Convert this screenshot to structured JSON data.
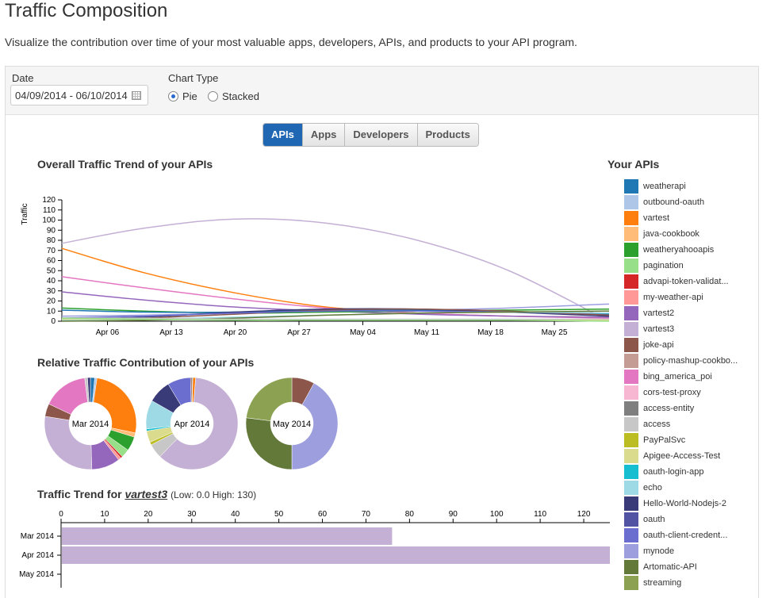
{
  "page": {
    "title": "Traffic Composition",
    "description": "Visualize the contribution over time of your most valuable apps, developers, APIs, and products to your API program."
  },
  "filters": {
    "date_label": "Date",
    "date_value": "04/09/2014 - 06/10/2014",
    "chart_type_label": "Chart Type",
    "chart_type_options": [
      "Pie",
      "Stacked"
    ],
    "chart_type_selected": "Pie"
  },
  "tabs": [
    {
      "label": "APIs",
      "active": true
    },
    {
      "label": "Apps",
      "active": false
    },
    {
      "label": "Developers",
      "active": false
    },
    {
      "label": "Products",
      "active": false
    }
  ],
  "sections": {
    "trend_title": "Overall Traffic Trend of your APIs",
    "relative_title": "Relative Traffic Contribution of your APIs",
    "legend_title": "Your APIs",
    "bar_title_prefix": "Traffic Trend for",
    "bar_title_api": "vartest3",
    "bar_title_range": "(Low: 0.0 High: 130)"
  },
  "legend": [
    {
      "name": "weatherapi",
      "color": "#1f77b4"
    },
    {
      "name": "outbound-oauth",
      "color": "#aec7e8"
    },
    {
      "name": "vartest",
      "color": "#ff7f0e"
    },
    {
      "name": "java-cookbook",
      "color": "#ffbb78"
    },
    {
      "name": "weatheryahooapis",
      "color": "#2ca02c"
    },
    {
      "name": "pagination",
      "color": "#98df8a"
    },
    {
      "name": "advapi-token-validat...",
      "color": "#d62728"
    },
    {
      "name": "my-weather-api",
      "color": "#ff9896"
    },
    {
      "name": "vartest2",
      "color": "#9467bd"
    },
    {
      "name": "vartest3",
      "color": "#c5b0d5"
    },
    {
      "name": "joke-api",
      "color": "#8c564b"
    },
    {
      "name": "policy-mashup-cookbo...",
      "color": "#c49c94"
    },
    {
      "name": "bing_america_poi",
      "color": "#e377c2"
    },
    {
      "name": "cors-test-proxy",
      "color": "#f7b6d2"
    },
    {
      "name": "access-entity",
      "color": "#7f7f7f"
    },
    {
      "name": "access",
      "color": "#c7c7c7"
    },
    {
      "name": "PayPalSvc",
      "color": "#bcbd22"
    },
    {
      "name": "Apigee-Access-Test",
      "color": "#dbdb8d"
    },
    {
      "name": "oauth-login-app",
      "color": "#17becf"
    },
    {
      "name": "echo",
      "color": "#9edae5"
    },
    {
      "name": "Hello-World-Nodejs-2",
      "color": "#393b79"
    },
    {
      "name": "oauth",
      "color": "#5254a3"
    },
    {
      "name": "oauth-client-credent...",
      "color": "#6b6ecf"
    },
    {
      "name": "mynode",
      "color": "#9c9ede"
    },
    {
      "name": "Artomatic-API",
      "color": "#637939"
    },
    {
      "name": "streaming",
      "color": "#8ca252"
    }
  ],
  "chart_data": [
    {
      "type": "line",
      "title": "Overall Traffic Trend of your APIs",
      "ylabel": "Traffic",
      "ylim": [
        0,
        120
      ],
      "yticks": [
        0,
        10,
        20,
        30,
        40,
        50,
        60,
        70,
        80,
        90,
        100,
        110,
        120
      ],
      "xticks": [
        "Apr 06",
        "Apr 13",
        "Apr 20",
        "Apr 27",
        "May 04",
        "May 11",
        "May 18",
        "May 25"
      ],
      "x": [
        "2014-04-01",
        "2014-04-10",
        "2014-04-20",
        "2014-04-30",
        "2014-05-10",
        "2014-05-20",
        "2014-05-31"
      ],
      "series": [
        {
          "name": "vartest3",
          "color": "#c5b0d5",
          "values": [
            77,
            92,
            101,
            97,
            80,
            50,
            0
          ]
        },
        {
          "name": "vartest",
          "color": "#ff7f0e",
          "values": [
            72,
            48,
            28,
            14,
            8,
            5,
            4
          ]
        },
        {
          "name": "bing_america_poi",
          "color": "#e377c2",
          "values": [
            44,
            33,
            22,
            13,
            8,
            5,
            3
          ]
        },
        {
          "name": "vartest2",
          "color": "#9467bd",
          "values": [
            29,
            21,
            14,
            10,
            7,
            5,
            4
          ]
        },
        {
          "name": "mynode",
          "color": "#9c9ede",
          "values": [
            5,
            6,
            8,
            10,
            11,
            13,
            17
          ]
        },
        {
          "name": "weatheryahooapis",
          "color": "#2ca02c",
          "values": [
            13,
            10,
            8,
            9,
            10,
            11,
            12
          ]
        },
        {
          "name": "weatherapi",
          "color": "#1f77b4",
          "values": [
            11,
            9,
            9,
            11,
            11,
            9,
            7
          ]
        },
        {
          "name": "Hello-World-Nodejs-2",
          "color": "#393b79",
          "values": [
            2,
            4,
            9,
            12,
            12,
            9,
            5
          ]
        },
        {
          "name": "joke-api",
          "color": "#8c564b",
          "values": [
            1,
            3,
            7,
            11,
            12,
            10,
            6
          ]
        },
        {
          "name": "oauth-client-credent...",
          "color": "#6b6ecf",
          "values": [
            3,
            5,
            8,
            10,
            10,
            9,
            8
          ]
        },
        {
          "name": "echo",
          "color": "#9edae5",
          "values": [
            1,
            2,
            4,
            6,
            8,
            9,
            8
          ]
        },
        {
          "name": "Artomatic-API",
          "color": "#637939",
          "values": [
            0,
            1,
            3,
            6,
            8,
            9,
            10
          ]
        },
        {
          "name": "access",
          "color": "#c7c7c7",
          "values": [
            3,
            3,
            2,
            2,
            2,
            2,
            2
          ]
        },
        {
          "name": "Apigee-Access-Test",
          "color": "#dbdb8d",
          "values": [
            2,
            2,
            1,
            1,
            1,
            1,
            1
          ]
        },
        {
          "name": "pagination",
          "color": "#98df8a",
          "values": [
            3,
            2,
            1,
            1,
            1,
            1,
            0
          ]
        }
      ]
    },
    {
      "type": "pie",
      "title": "Relative Traffic Contribution of your APIs",
      "charts": [
        {
          "label": "Mar 2014",
          "slices": [
            {
              "name": "weatherapi",
              "value": 1.5,
              "color": "#1f77b4"
            },
            {
              "name": "outbound-oauth",
              "value": 0.8,
              "color": "#aec7e8"
            },
            {
              "name": "vartest",
              "value": 26,
              "color": "#ff7f0e"
            },
            {
              "name": "java-cookbook",
              "value": 1.5,
              "color": "#ffbb78"
            },
            {
              "name": "weatheryahooapis",
              "value": 5,
              "color": "#2ca02c"
            },
            {
              "name": "pagination",
              "value": 3,
              "color": "#98df8a"
            },
            {
              "name": "advapi-token-validat...",
              "value": 0.7,
              "color": "#d62728"
            },
            {
              "name": "my-weather-api",
              "value": 1,
              "color": "#ff9896"
            },
            {
              "name": "vartest2",
              "value": 10,
              "color": "#9467bd"
            },
            {
              "name": "vartest3",
              "value": 28,
              "color": "#c5b0d5"
            },
            {
              "name": "joke-api",
              "value": 4.5,
              "color": "#8c564b"
            },
            {
              "name": "bing_america_poi",
              "value": 16,
              "color": "#e377c2"
            },
            {
              "name": "access",
              "value": 1,
              "color": "#c7c7c7"
            },
            {
              "name": "Hello-World-Nodejs-2",
              "value": 1,
              "color": "#393b79"
            }
          ]
        },
        {
          "label": "Apr 2014",
          "slices": [
            {
              "name": "weatherapi",
              "value": 0.3,
              "color": "#1f77b4"
            },
            {
              "name": "vartest",
              "value": 1,
              "color": "#ff7f0e"
            },
            {
              "name": "vartest3",
              "value": 60,
              "color": "#c5b0d5"
            },
            {
              "name": "access",
              "value": 5,
              "color": "#c7c7c7"
            },
            {
              "name": "PayPalSvc",
              "value": 1,
              "color": "#bcbd22"
            },
            {
              "name": "Apigee-Access-Test",
              "value": 4,
              "color": "#dbdb8d"
            },
            {
              "name": "oauth-login-app",
              "value": 0.7,
              "color": "#17becf"
            },
            {
              "name": "echo",
              "value": 10,
              "color": "#9edae5"
            },
            {
              "name": "Hello-World-Nodejs-2",
              "value": 8,
              "color": "#393b79"
            },
            {
              "name": "oauth-client-credent...",
              "value": 8,
              "color": "#6b6ecf"
            },
            {
              "name": "joke-api",
              "value": 0.5,
              "color": "#8c564b"
            }
          ]
        },
        {
          "label": "May 2014",
          "slices": [
            {
              "name": "joke-api",
              "value": 8,
              "color": "#8c564b"
            },
            {
              "name": "mynode",
              "value": 42,
              "color": "#9c9ede"
            },
            {
              "name": "Artomatic-API",
              "value": 27,
              "color": "#637939"
            },
            {
              "name": "streaming",
              "value": 23,
              "color": "#8ca252"
            }
          ]
        }
      ]
    },
    {
      "type": "bar",
      "title": "Traffic Trend for vartest3",
      "orientation": "horizontal",
      "categories": [
        "Mar 2014",
        "Apr 2014",
        "May 2014"
      ],
      "values": [
        76,
        126,
        0
      ],
      "xlim": [
        0,
        126
      ],
      "xticks": [
        0,
        10,
        20,
        30,
        40,
        50,
        60,
        70,
        80,
        90,
        100,
        110,
        120
      ],
      "color": "#c5b0d5"
    }
  ]
}
